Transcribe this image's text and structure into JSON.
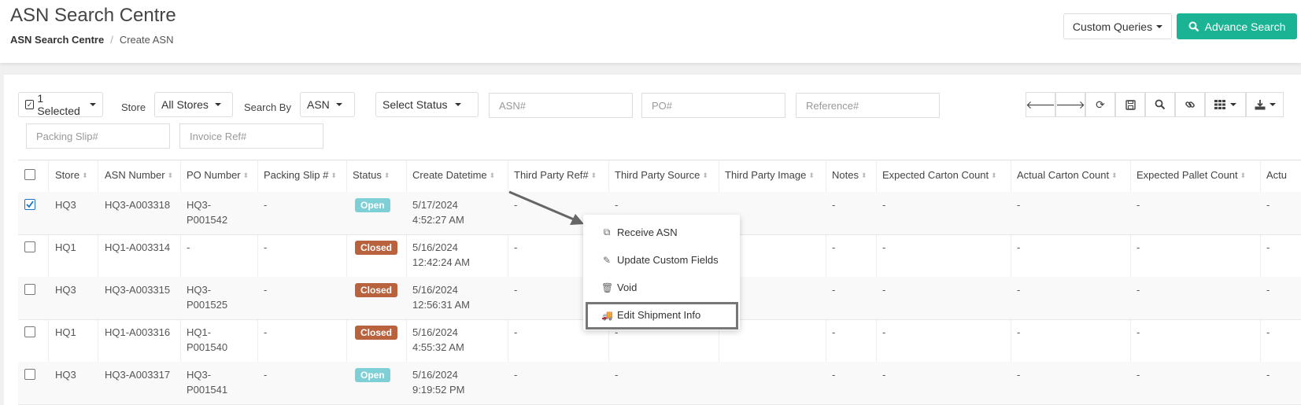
{
  "header": {
    "title": "ASN Search Centre",
    "breadcrumb": [
      "ASN Search Centre",
      "Create ASN"
    ],
    "custom_queries": "Custom Queries",
    "advance_search": "Advance Search"
  },
  "filters": {
    "selected": "1 Selected",
    "store_label": "Store",
    "store_value": "All Stores",
    "search_by_label": "Search By",
    "search_by_value": "ASN",
    "status_value": "Select Status",
    "asn_placeholder": "ASN#",
    "po_placeholder": "PO#",
    "reference_placeholder": "Reference#",
    "packing_slip_placeholder": "Packing Slip#",
    "invoice_placeholder": "Invoice Ref#"
  },
  "toolbar": [
    "arrow-left-icon",
    "arrow-right-icon",
    "refresh-icon",
    "save-icon",
    "search-icon",
    "link-icon",
    "columns-icon",
    "download-icon"
  ],
  "columns": [
    "Store",
    "ASN Number",
    "PO Number",
    "Packing Slip #",
    "Status",
    "Create Datetime",
    "Third Party Ref#",
    "Third Party Source",
    "Third Party Image",
    "Notes",
    "Expected Carton Count",
    "Actual Carton Count",
    "Expected Pallet Count",
    "Actu"
  ],
  "rows": [
    {
      "checked": true,
      "store": "HQ3",
      "asn": "HQ3-A003318",
      "po1": "HQ3-",
      "po2": "P001542",
      "slip": "-",
      "status": "Open",
      "date": "5/17/2024",
      "time": "4:52:27 AM",
      "tpref": "-",
      "tpsource": "-",
      "tpimage": "",
      "notes": "-",
      "ecc": "-",
      "acc": "-",
      "epc": "-",
      "actu": "-"
    },
    {
      "checked": false,
      "store": "HQ1",
      "asn": "HQ1-A003314",
      "po1": "-",
      "po2": "",
      "slip": "-",
      "status": "Closed",
      "date": "5/16/2024",
      "time": "12:42:24 AM",
      "tpref": "-",
      "tpsource": "",
      "tpimage": "",
      "notes": "-",
      "ecc": "-",
      "acc": "-",
      "epc": "-",
      "actu": "-"
    },
    {
      "checked": false,
      "store": "HQ3",
      "asn": "HQ3-A003315",
      "po1": "HQ3-",
      "po2": "P001525",
      "slip": "-",
      "status": "Closed",
      "date": "5/16/2024",
      "time": "12:56:31 AM",
      "tpref": "-",
      "tpsource": "",
      "tpimage": "",
      "notes": "-",
      "ecc": "-",
      "acc": "-",
      "epc": "-",
      "actu": "-"
    },
    {
      "checked": false,
      "store": "HQ1",
      "asn": "HQ1-A003316",
      "po1": "HQ1-",
      "po2": "P001540",
      "slip": "-",
      "status": "Closed",
      "date": "5/16/2024",
      "time": "4:55:32 AM",
      "tpref": "-",
      "tpsource": "-",
      "tpimage": "",
      "notes": "-",
      "ecc": "-",
      "acc": "-",
      "epc": "-",
      "actu": "-"
    },
    {
      "checked": false,
      "store": "HQ3",
      "asn": "HQ3-A003317",
      "po1": "HQ3-",
      "po2": "P001541",
      "slip": "-",
      "status": "Open",
      "date": "5/16/2024",
      "time": "9:19:52 PM",
      "tpref": "-",
      "tpsource": "-",
      "tpimage": "",
      "notes": "-",
      "ecc": "-",
      "acc": "-",
      "epc": "-",
      "actu": "-"
    }
  ],
  "context_menu": {
    "items": [
      "Receive ASN",
      "Update Custom Fields",
      "Void",
      "Edit Shipment Info"
    ],
    "highlighted": "Edit Shipment Info"
  },
  "colors": {
    "accent": "#1ab394",
    "open": "#7fd0d6",
    "closed": "#b8623e"
  }
}
